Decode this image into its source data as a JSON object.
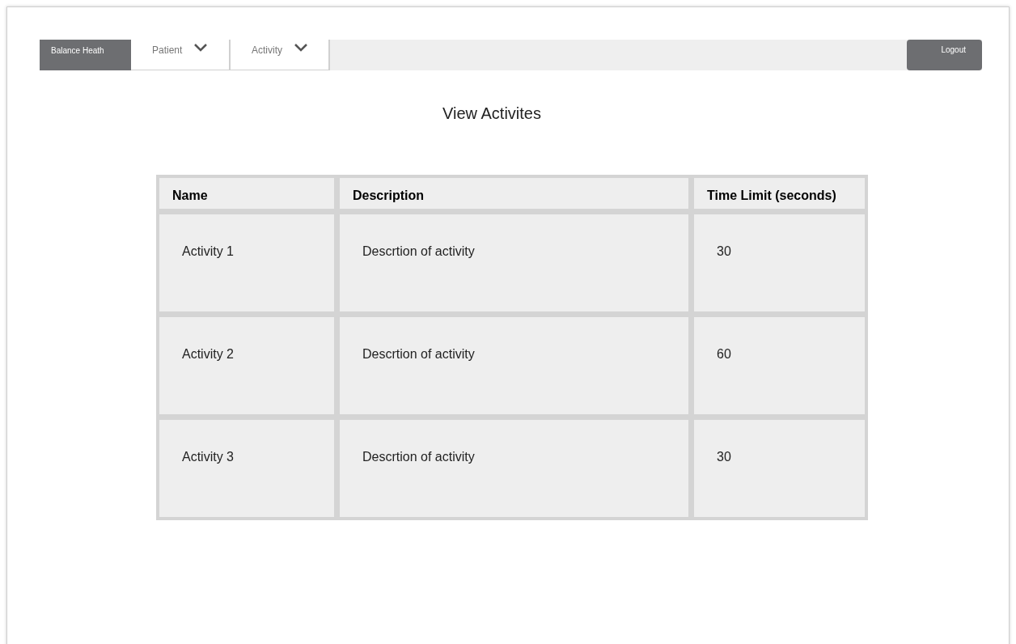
{
  "nav": {
    "brand": "Balance Heath",
    "menus": [
      {
        "label": "Patient"
      },
      {
        "label": "Activity"
      }
    ],
    "logout": "Logout"
  },
  "title": "View Activites",
  "table": {
    "columns": [
      "Name",
      "Description",
      "Time Limit (seconds)"
    ],
    "rows": [
      [
        "Activity 1",
        "Descrtion of activity",
        "30"
      ],
      [
        "Activity 2",
        "Descrtion of activity",
        "60"
      ],
      [
        "Activity 3",
        "Descrtion of activity",
        "30"
      ]
    ]
  }
}
